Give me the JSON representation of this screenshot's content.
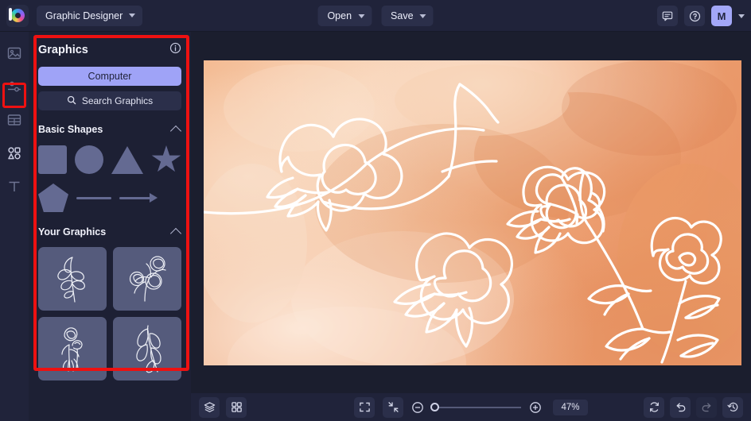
{
  "app": {
    "logo_icon": "color-wheel-logo",
    "project_name": "Graphic Designer"
  },
  "topbar": {
    "open_label": "Open",
    "save_label": "Save",
    "feedback_icon": "comment-icon",
    "help_icon": "question-circle-icon",
    "avatar_initial": "M",
    "account_caret_icon": "chevron-down-icon"
  },
  "rail": {
    "items": [
      {
        "icon": "image-icon",
        "name": "image"
      },
      {
        "icon": "sliders-icon",
        "name": "adjustments"
      },
      {
        "icon": "frames-icon",
        "name": "layouts"
      },
      {
        "icon": "shapes-icon",
        "name": "graphics"
      },
      {
        "icon": "text-icon",
        "name": "text"
      }
    ],
    "selected": "graphics"
  },
  "panel": {
    "title": "Graphics",
    "info_icon": "info-circle-icon",
    "computer_label": "Computer",
    "search_label": "Search Graphics",
    "search_icon": "search-icon",
    "sections": [
      {
        "title": "Basic Shapes",
        "collapse_icon": "chevron-up-icon",
        "shapes": [
          "square",
          "circle",
          "triangle",
          "star",
          "pentagon",
          "line",
          "arrow"
        ]
      },
      {
        "title": "Your Graphics",
        "collapse_icon": "chevron-up-icon",
        "thumbnails": [
          "leaf-sprig-line-art",
          "peony-bouquet-line-art",
          "poppy-flowers-line-art",
          "foliage-branch-line-art"
        ]
      }
    ]
  },
  "canvas": {
    "background_color": "#f3bb95",
    "art_color": "#ffffff",
    "artwork": "watercolor-peach-background-with-white-line-art-florals"
  },
  "bottombar": {
    "layers_icon": "layers-icon",
    "grid_icon": "grid-icon",
    "fit_icon": "expand-frame-icon",
    "shrink_icon": "collapse-frame-icon",
    "zoom_out_icon": "minus-circle-icon",
    "zoom_in_icon": "plus-circle-icon",
    "zoom_value": "47%",
    "zoom_percent": 47,
    "refresh_icon": "sync-icon",
    "undo_icon": "undo-icon",
    "redo_icon": "redo-icon",
    "history_icon": "history-icon"
  },
  "highlights": {
    "rail_shapes_box_color": "#ee1111",
    "panel_box_color": "#ee1111"
  }
}
